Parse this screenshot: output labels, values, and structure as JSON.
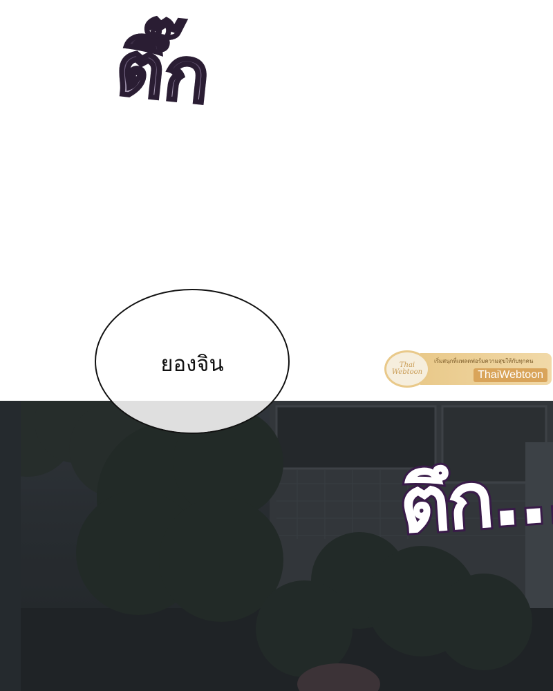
{
  "sfx": {
    "top": "ตึ๊ก",
    "bottom": "ตึก..."
  },
  "speech_bubble": {
    "text": "ยองจิน"
  },
  "watermark": {
    "logo_line1": "Thai",
    "logo_line2": "Webtoon",
    "tagline": "เริ่มสนุกที่แพลตฟอร์มความสุขให้กับทุกคน",
    "brand": "ThaiWebtoon"
  },
  "colors": {
    "sfx_outline": "#3a1c4a",
    "night_background": "#2f3438",
    "watermark_gold": "#e9c98a"
  }
}
